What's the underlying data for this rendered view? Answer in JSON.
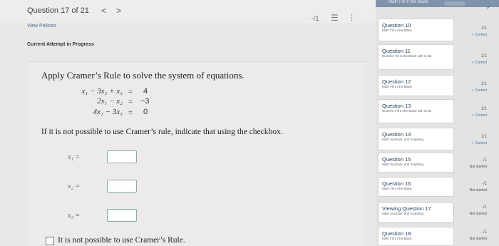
{
  "header": {
    "question_counter": "Question 17 of 21",
    "prev_glyph": "<",
    "next_glyph": ">",
    "score": "-/1",
    "list_glyph": "☰",
    "more_glyph": "⋮"
  },
  "links": {
    "view_policies": "View Policies",
    "attempt_status": "Current Attempt in Progress"
  },
  "question": {
    "prompt": "Apply Cramer’s Rule to solve the system of equations.",
    "equations": [
      {
        "lhs": "x₁ − 3x₂ + x₃",
        "sign": "=",
        "rhs": "4"
      },
      {
        "lhs": "2x₁ − x₂",
        "sign": "=",
        "rhs": "−3"
      },
      {
        "lhs": "4x₁ − 3x₃",
        "sign": "=",
        "rhs": "0"
      }
    ],
    "note": "If it is not possible to use Cramer’s rule, indicate that using the checkbox.",
    "answers": [
      {
        "label": "x₁ =",
        "value": ""
      },
      {
        "label": "x₂ =",
        "value": ""
      },
      {
        "label": "x₃ =",
        "value": ""
      }
    ],
    "checkbox_label": "It is not possible to use Cramer’s Rule.",
    "checkbox_checked": false
  },
  "panel": {
    "header_text": "Math Fill in the Blank",
    "top_check": "✓",
    "items": [
      {
        "title": "Question 10",
        "subtitle": "Math Fill in the Blank",
        "score": "1/1",
        "status": "✓ Correct",
        "state": "correct",
        "active": false
      },
      {
        "title": "Question 11",
        "subtitle": "Numeric Fill in the Blank with Units",
        "score": "1/1",
        "status": "✓ Correct",
        "state": "correct",
        "active": false
      },
      {
        "title": "Question 12",
        "subtitle": "Math Fill in the Blank",
        "score": "1/1",
        "status": "✓ Correct",
        "state": "correct",
        "active": false
      },
      {
        "title": "Question 13",
        "subtitle": "Numeric Fill in the Blank with Units",
        "score": "1/1",
        "status": "✓ Correct",
        "state": "correct",
        "active": false
      },
      {
        "title": "Question 14",
        "subtitle": "Math Symbolic and Graphing",
        "score": "1/1",
        "status": "✓ Correct",
        "state": "correct",
        "active": false
      },
      {
        "title": "Question 15",
        "subtitle": "Math Symbolic and Graphing",
        "score": "-/1",
        "status": "Not started",
        "state": "not-started",
        "active": false
      },
      {
        "title": "Question 16",
        "subtitle": "Math Fill in the Blank",
        "score": "-/1",
        "status": "Not started",
        "state": "not-started",
        "active": false
      },
      {
        "title": "Viewing Question 17",
        "subtitle": "Math Symbolic and Graphing",
        "score": "-/1",
        "status": "Not started",
        "state": "not-started",
        "active": true
      },
      {
        "title": "Question 18",
        "subtitle": "Math Fill in the Blank",
        "score": "-/1",
        "status": "Not started",
        "state": "not-started",
        "active": false
      }
    ]
  }
}
